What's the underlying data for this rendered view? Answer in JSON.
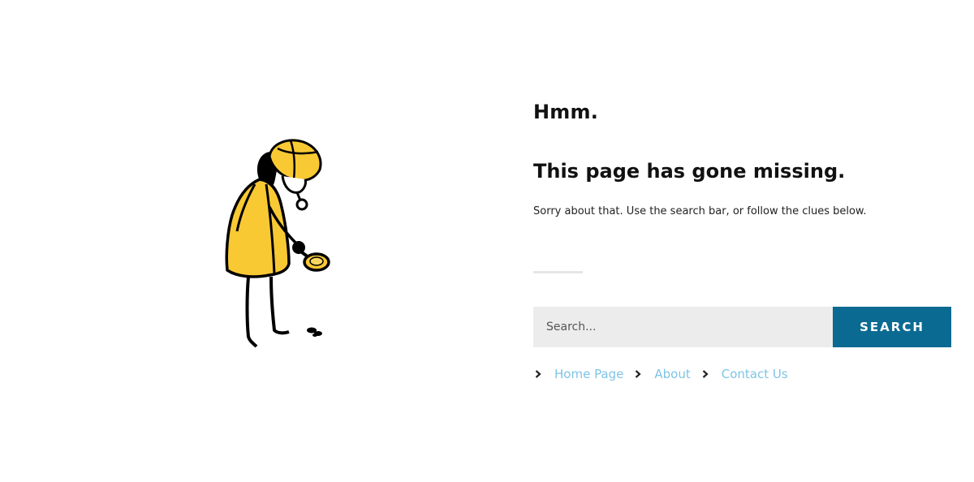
{
  "illustration": {
    "name": "detective-with-magnifying-glass",
    "coat_color": "#f9c934",
    "outline_color": "#000000"
  },
  "page": {
    "heading_small": "Hmm.",
    "heading_main": "This page has gone missing.",
    "subtitle": "Sorry about that. Use the search bar, or follow the clues below."
  },
  "search": {
    "placeholder": "Search...",
    "value": "",
    "button_label": "SEARCH",
    "button_color": "#0b6a92"
  },
  "links": [
    {
      "label": "Home Page",
      "icon": "chevron-right-icon"
    },
    {
      "label": "About",
      "icon": "chevron-right-icon"
    },
    {
      "label": "Contact Us",
      "icon": "chevron-right-icon"
    }
  ],
  "colors": {
    "link": "#7ec4e6",
    "divider": "#e6e6e6",
    "input_bg": "#ececec"
  }
}
